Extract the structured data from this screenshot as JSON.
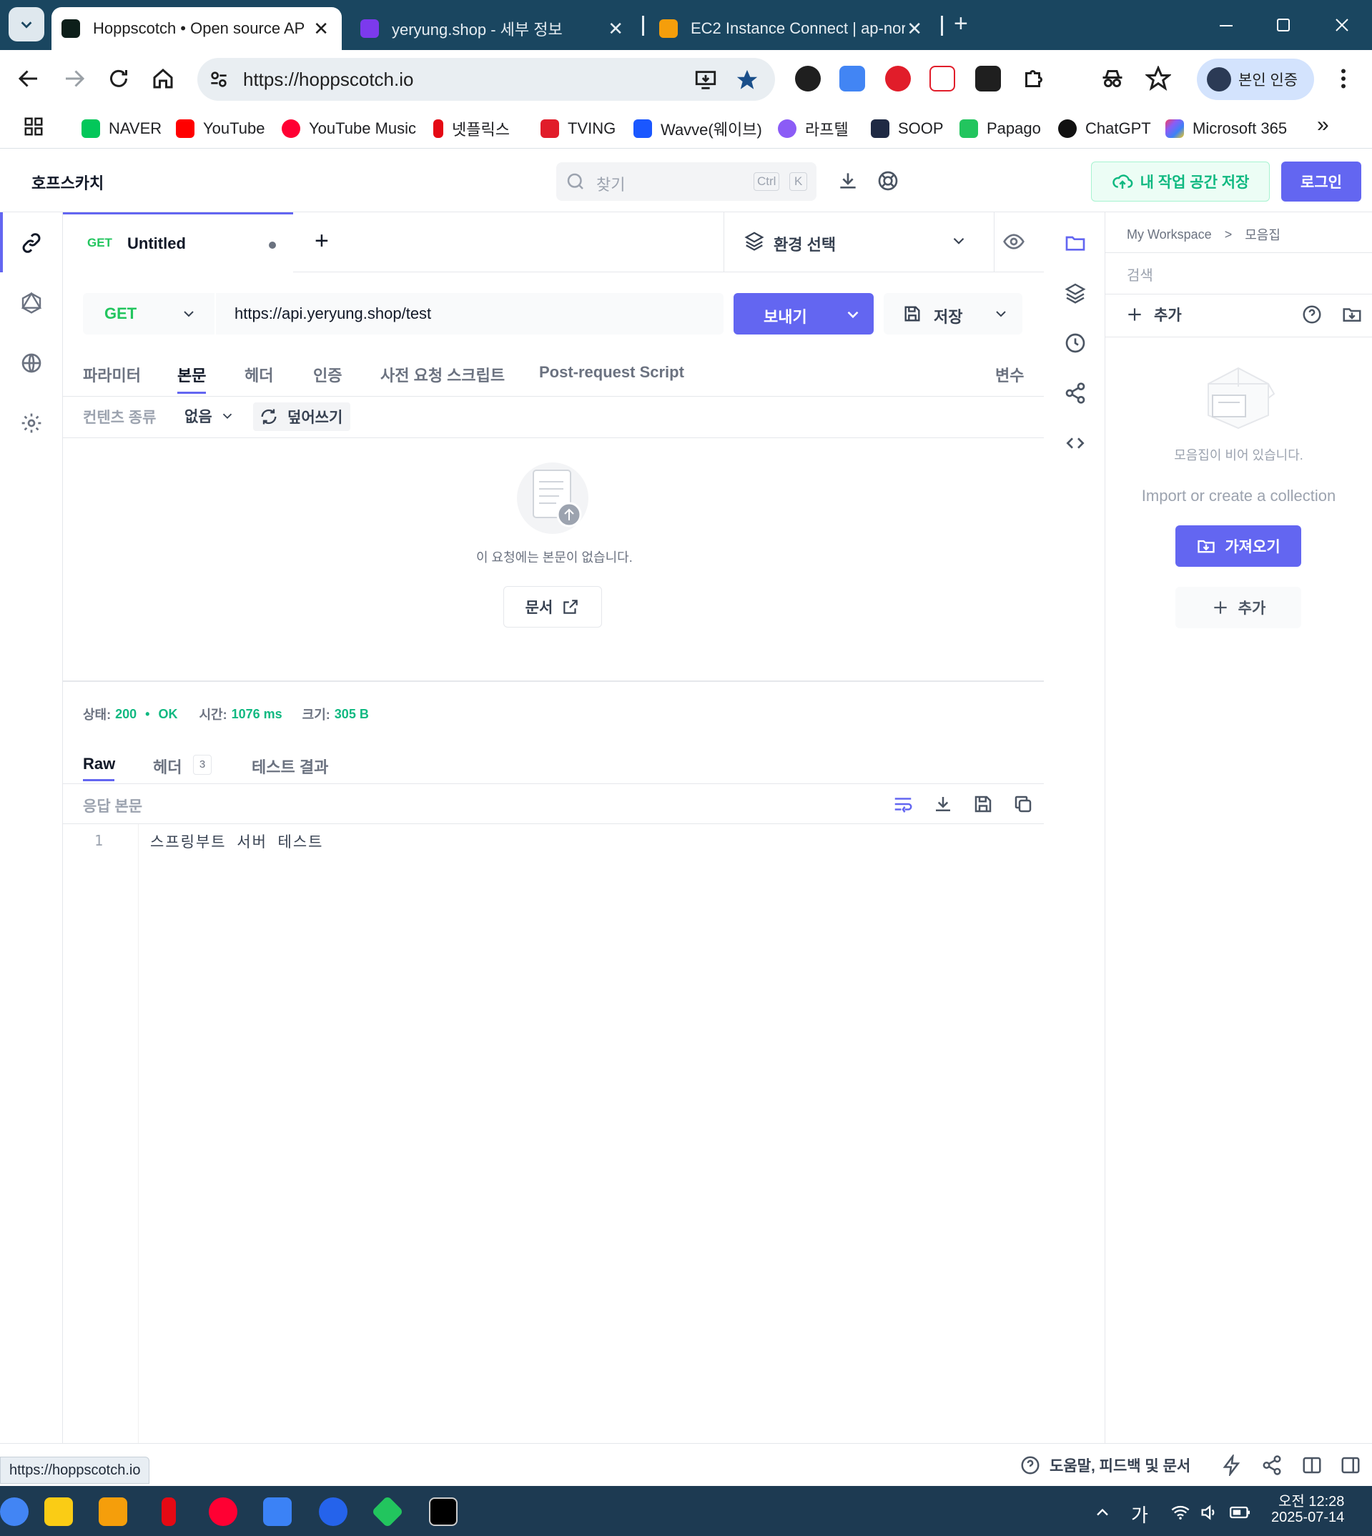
{
  "browser": {
    "tabs": [
      {
        "title": "Hoppscotch • Open source AP",
        "active": true
      },
      {
        "title": "yeryung.shop - 세부 정보",
        "active": false
      },
      {
        "title": "EC2 Instance Connect | ap-nor",
        "active": false
      }
    ],
    "new_tab": "+",
    "url": "https://hoppscotch.io",
    "profile_label": "본인 인증",
    "bookmarks": [
      "NAVER",
      "YouTube",
      "YouTube Music",
      "넷플릭스",
      "TVING",
      "Wavve(웨이브)",
      "라프텔",
      "SOOP",
      "Papago",
      "ChatGPT",
      "Microsoft 365"
    ],
    "bookmarks_more": "»",
    "status_url": "https://hoppscotch.io"
  },
  "app": {
    "logo": "호프스카치",
    "search_placeholder": "찾기",
    "search_kbd": [
      "Ctrl",
      "K"
    ],
    "save_workspace": "내 작업 공간 저장",
    "login": "로그인"
  },
  "request_tab": {
    "method": "GET",
    "title": "Untitled",
    "add": "+",
    "env_select": "환경 선택"
  },
  "request": {
    "method": "GET",
    "url": "https://api.yeryung.shop/test",
    "send": "보내기",
    "save": "저장",
    "tabs": [
      "파라미터",
      "본문",
      "헤더",
      "인증",
      "사전 요청 스크립트",
      "Post-request Script"
    ],
    "active_tab": "본문",
    "variables": "변수",
    "content_type_label": "컨텐츠 종류",
    "content_type_value": "없음",
    "overwrite": "덮어쓰기",
    "empty_body": "이 요청에는 본문이 없습니다.",
    "docs": "문서"
  },
  "response": {
    "status_label": "상태:",
    "status_code": "200",
    "status_sep": "•",
    "status_text": "OK",
    "time_label": "시간:",
    "time_value": "1076 ms",
    "size_label": "크기:",
    "size_value": "305 B",
    "tabs": [
      "Raw",
      "헤더",
      "테스트 결과"
    ],
    "headers_count": "3",
    "body_label": "응답 본문",
    "lines": [
      {
        "num": "1",
        "text": "스프링부트 서버 테스트"
      }
    ]
  },
  "collections": {
    "breadcrumb_root": "My Workspace",
    "breadcrumb_sep": ">",
    "breadcrumb_current": "모음집",
    "search_placeholder": "검색",
    "add": "추가",
    "empty": "모음집이 비어 있습니다.",
    "hint": "Import or create a collection",
    "import": "가져오기",
    "add_button": "추가"
  },
  "footer": {
    "help": "도움말, 피드백 및 문서"
  },
  "taskbar": {
    "ime": "가",
    "time": "오전 12:28",
    "date": "2025-07-14"
  },
  "colors": {
    "accent": "#6366f1",
    "green": "#10b981",
    "chrome": "#1a4660"
  }
}
